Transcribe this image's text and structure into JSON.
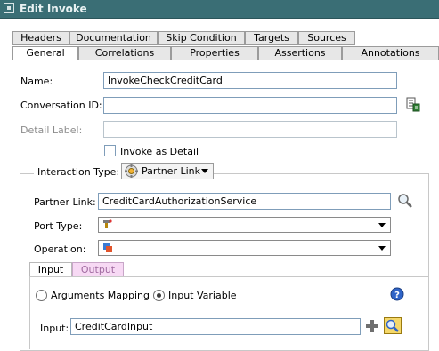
{
  "window": {
    "title": "Edit Invoke"
  },
  "tabs_row1": [
    {
      "label": "Headers"
    },
    {
      "label": "Documentation"
    },
    {
      "label": "Skip Condition"
    },
    {
      "label": "Targets"
    },
    {
      "label": "Sources"
    }
  ],
  "tabs_row2": [
    {
      "label": "General",
      "selected": true
    },
    {
      "label": "Correlations"
    },
    {
      "label": "Properties"
    },
    {
      "label": "Assertions"
    },
    {
      "label": "Annotations"
    }
  ],
  "form": {
    "name_label": "Name:",
    "name_value": "InvokeCheckCreditCard",
    "conversation_label": "Conversation ID:",
    "conversation_value": "",
    "detail_label_label": "Detail Label:",
    "detail_label_value": "",
    "invoke_as_detail_label": "Invoke as Detail",
    "invoke_as_detail_checked": false
  },
  "interaction": {
    "label": "Interaction Type:",
    "type_value": "Partner Link",
    "partner_link_label": "Partner Link:",
    "partner_link_value": "CreditCardAuthorizationService",
    "port_type_label": "Port Type:",
    "port_type_value": "",
    "operation_label": "Operation:",
    "operation_value": ""
  },
  "io_tabs": [
    {
      "label": "Input",
      "selected": true
    },
    {
      "label": "Output",
      "selected": false
    }
  ],
  "input": {
    "arguments_mapping_label": "Arguments Mapping",
    "input_variable_label": "Input Variable",
    "selected_mode": "Input Variable",
    "input_label": "Input:",
    "input_value": "CreditCardInput"
  },
  "colors": {
    "title_bar": "#3a6e75",
    "output_tab": "#f7d9f4",
    "help_blue": "#2f64c8"
  }
}
